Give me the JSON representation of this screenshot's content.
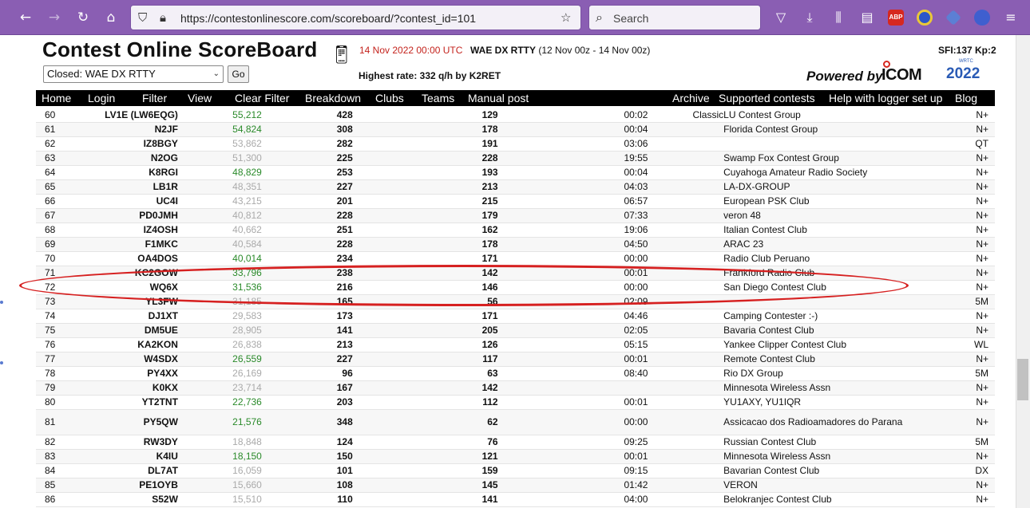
{
  "browser": {
    "url": "https://contestonlinescore.com/scoreboard/?contest_id=101",
    "search_placeholder": "Search",
    "abp_label": "ABP"
  },
  "header": {
    "title": "Contest Online ScoreBoard",
    "datetime": "14 Nov 2022 00:00 UTC",
    "contest_name": "WAE DX RTTY",
    "contest_period": "(12 Nov 00z - 14 Nov 00z)",
    "sfi": "SFI:137 Kp:2",
    "contest_select_value": "Closed: WAE DX RTTY",
    "go_label": "Go",
    "highest_rate": "Highest rate: 332 q/h by K2RET",
    "powered_by": "Powered by",
    "icom": "ICOM",
    "wrtc_year": "2022",
    "wrtc_small": "WRTC"
  },
  "menu": {
    "home": "Home",
    "login": "Login",
    "filter": "Filter",
    "view": "View",
    "clear_filter": "Clear Filter",
    "breakdown": "Breakdown",
    "clubs": "Clubs",
    "teams": "Teams",
    "manual_post": "Manual post",
    "archive": "Archive",
    "supported": "Supported contests",
    "help": "Help with logger set up",
    "blog": "Blog"
  },
  "rows": [
    {
      "rank": "60",
      "call": "LV1E (LW6EQG)",
      "score": "55,212",
      "score_color": "green",
      "qsos": "428",
      "mults": "129",
      "time": "00:02",
      "cat": "Classic",
      "club": "LU Contest Group",
      "power": "N+"
    },
    {
      "rank": "61",
      "call": "N2JF",
      "score": "54,824",
      "score_color": "green",
      "qsos": "308",
      "mults": "178",
      "time": "00:04",
      "cat": "",
      "club": "Florida Contest Group",
      "power": "N+"
    },
    {
      "rank": "62",
      "call": "IZ8BGY",
      "score": "53,862",
      "score_color": "grey",
      "qsos": "282",
      "mults": "191",
      "time": "03:06",
      "cat": "",
      "club": "",
      "power": "QT"
    },
    {
      "rank": "63",
      "call": "N2OG",
      "score": "51,300",
      "score_color": "grey",
      "qsos": "225",
      "mults": "228",
      "time": "19:55",
      "cat": "",
      "club": "Swamp Fox Contest Group",
      "power": "N+"
    },
    {
      "rank": "64",
      "call": "K8RGI",
      "score": "48,829",
      "score_color": "green",
      "qsos": "253",
      "mults": "193",
      "time": "00:04",
      "cat": "",
      "club": "Cuyahoga Amateur Radio Society",
      "power": "N+"
    },
    {
      "rank": "65",
      "call": "LB1R",
      "score": "48,351",
      "score_color": "grey",
      "qsos": "227",
      "mults": "213",
      "time": "04:03",
      "cat": "",
      "club": "LA-DX-GROUP",
      "power": "N+"
    },
    {
      "rank": "66",
      "call": "UC4I",
      "score": "43,215",
      "score_color": "grey",
      "qsos": "201",
      "mults": "215",
      "time": "06:57",
      "cat": "",
      "club": "European PSK Club",
      "power": "N+"
    },
    {
      "rank": "67",
      "call": "PD0JMH",
      "score": "40,812",
      "score_color": "grey",
      "qsos": "228",
      "mults": "179",
      "time": "07:33",
      "cat": "",
      "club": "veron 48",
      "power": "N+"
    },
    {
      "rank": "68",
      "call": "IZ4OSH",
      "score": "40,662",
      "score_color": "grey",
      "qsos": "251",
      "mults": "162",
      "time": "19:06",
      "cat": "",
      "club": "Italian Contest Club",
      "power": "N+"
    },
    {
      "rank": "69",
      "call": "F1MKC",
      "score": "40,584",
      "score_color": "grey",
      "qsos": "228",
      "mults": "178",
      "time": "04:50",
      "cat": "",
      "club": "ARAC 23",
      "power": "N+"
    },
    {
      "rank": "70",
      "call": "OA4DOS",
      "score": "40,014",
      "score_color": "green",
      "qsos": "234",
      "mults": "171",
      "time": "00:00",
      "cat": "",
      "club": "Radio Club Peruano",
      "power": "N+"
    },
    {
      "rank": "71",
      "call": "KC2GOW",
      "score": "33,796",
      "score_color": "green",
      "qsos": "238",
      "mults": "142",
      "time": "00:01",
      "cat": "",
      "club": "Frankford Radio Club",
      "power": "N+"
    },
    {
      "rank": "72",
      "call": "WQ6X",
      "score": "31,536",
      "score_color": "green",
      "qsos": "216",
      "mults": "146",
      "time": "00:00",
      "cat": "",
      "club": "San Diego Contest Club",
      "power": "N+"
    },
    {
      "rank": "73",
      "call": "YL3FW",
      "score": "31,185",
      "score_color": "grey",
      "qsos": "165",
      "mults": "56",
      "time": "02:09",
      "cat": "",
      "club": "",
      "power": "5M"
    },
    {
      "rank": "74",
      "call": "DJ1XT",
      "score": "29,583",
      "score_color": "grey",
      "qsos": "173",
      "mults": "171",
      "time": "04:46",
      "cat": "",
      "club": "Camping Contester :-)",
      "power": "N+"
    },
    {
      "rank": "75",
      "call": "DM5UE",
      "score": "28,905",
      "score_color": "grey",
      "qsos": "141",
      "mults": "205",
      "time": "02:05",
      "cat": "",
      "club": "Bavaria Contest Club",
      "power": "N+"
    },
    {
      "rank": "76",
      "call": "KA2KON",
      "score": "26,838",
      "score_color": "grey",
      "qsos": "213",
      "mults": "126",
      "time": "05:15",
      "cat": "",
      "club": "Yankee Clipper Contest Club",
      "power": "WL"
    },
    {
      "rank": "77",
      "call": "W4SDX",
      "score": "26,559",
      "score_color": "green",
      "qsos": "227",
      "mults": "117",
      "time": "00:01",
      "cat": "",
      "club": "Remote Contest Club",
      "power": "N+"
    },
    {
      "rank": "78",
      "call": "PY4XX",
      "score": "26,169",
      "score_color": "grey",
      "qsos": "96",
      "mults": "63",
      "time": "08:40",
      "cat": "",
      "club": "Rio DX Group",
      "power": "5M"
    },
    {
      "rank": "79",
      "call": "K0KX",
      "score": "23,714",
      "score_color": "grey",
      "qsos": "167",
      "mults": "142",
      "time": "",
      "cat": "",
      "club": "Minnesota Wireless Assn",
      "power": "N+"
    },
    {
      "rank": "80",
      "call": "YT2TNT",
      "score": "22,736",
      "score_color": "green",
      "qsos": "203",
      "mults": "112",
      "time": "00:01",
      "cat": "",
      "club": "YU1AXY, YU1IQR",
      "power": "N+"
    },
    {
      "rank": "81",
      "call": "PY5QW",
      "score": "21,576",
      "score_color": "green",
      "qsos": "348",
      "mults": "62",
      "time": "00:00",
      "cat": "",
      "club": "Assicacao dos Radioamadores do Parana",
      "power": "N+",
      "tall": true
    },
    {
      "rank": "82",
      "call": "RW3DY",
      "score": "18,848",
      "score_color": "grey",
      "qsos": "124",
      "mults": "76",
      "time": "09:25",
      "cat": "",
      "club": "Russian Contest Club",
      "power": "5M"
    },
    {
      "rank": "83",
      "call": "K4IU",
      "score": "18,150",
      "score_color": "green",
      "qsos": "150",
      "mults": "121",
      "time": "00:01",
      "cat": "",
      "club": "Minnesota Wireless Assn",
      "power": "N+"
    },
    {
      "rank": "84",
      "call": "DL7AT",
      "score": "16,059",
      "score_color": "grey",
      "qsos": "101",
      "mults": "159",
      "time": "09:15",
      "cat": "",
      "club": "Bavarian Contest Club",
      "power": "DX"
    },
    {
      "rank": "85",
      "call": "PE1OYB",
      "score": "15,660",
      "score_color": "grey",
      "qsos": "108",
      "mults": "145",
      "time": "01:42",
      "cat": "",
      "club": "VERON",
      "power": "N+"
    },
    {
      "rank": "86",
      "call": "S52W",
      "score": "15,510",
      "score_color": "grey",
      "qsos": "110",
      "mults": "141",
      "time": "04:00",
      "cat": "",
      "club": "Belokranjec Contest Club",
      "power": "N+"
    }
  ]
}
